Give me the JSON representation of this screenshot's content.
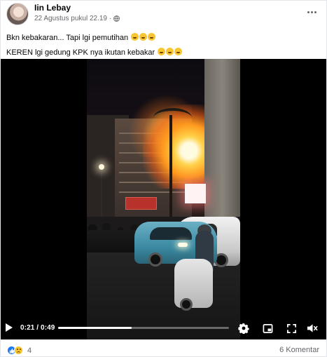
{
  "post": {
    "author": "Iin Lebay",
    "timestamp": "22 Agustus pukul 22.19",
    "separator": "·",
    "privacy_icon": "globe-icon",
    "more_icon": "more-options-icon",
    "caption_lines": [
      {
        "text": "Bkn kebakaran... Tapi lgi pemutihan",
        "emoji_count": 3,
        "emoji": "laughing-emoji"
      },
      {
        "text": "KEREN lgi gedung KPK nya ikutan kebakar",
        "emoji_count": 3,
        "emoji": "grinning-emoji"
      }
    ]
  },
  "video": {
    "current_time": "0:21",
    "duration": "0:49",
    "time_display": "0:21 / 0:49",
    "progress": 0.43,
    "controls": [
      "settings-icon",
      "picture-in-picture-icon",
      "fullscreen-icon",
      "volume-icon"
    ]
  },
  "footer": {
    "reaction_icons": [
      "like-icon",
      "sad-icon"
    ],
    "reaction_count": "4",
    "comments": "6 Komentar"
  },
  "colors": {
    "accent": "#1877f2",
    "secondary_text": "#65676b",
    "video_bg": "#000000"
  }
}
